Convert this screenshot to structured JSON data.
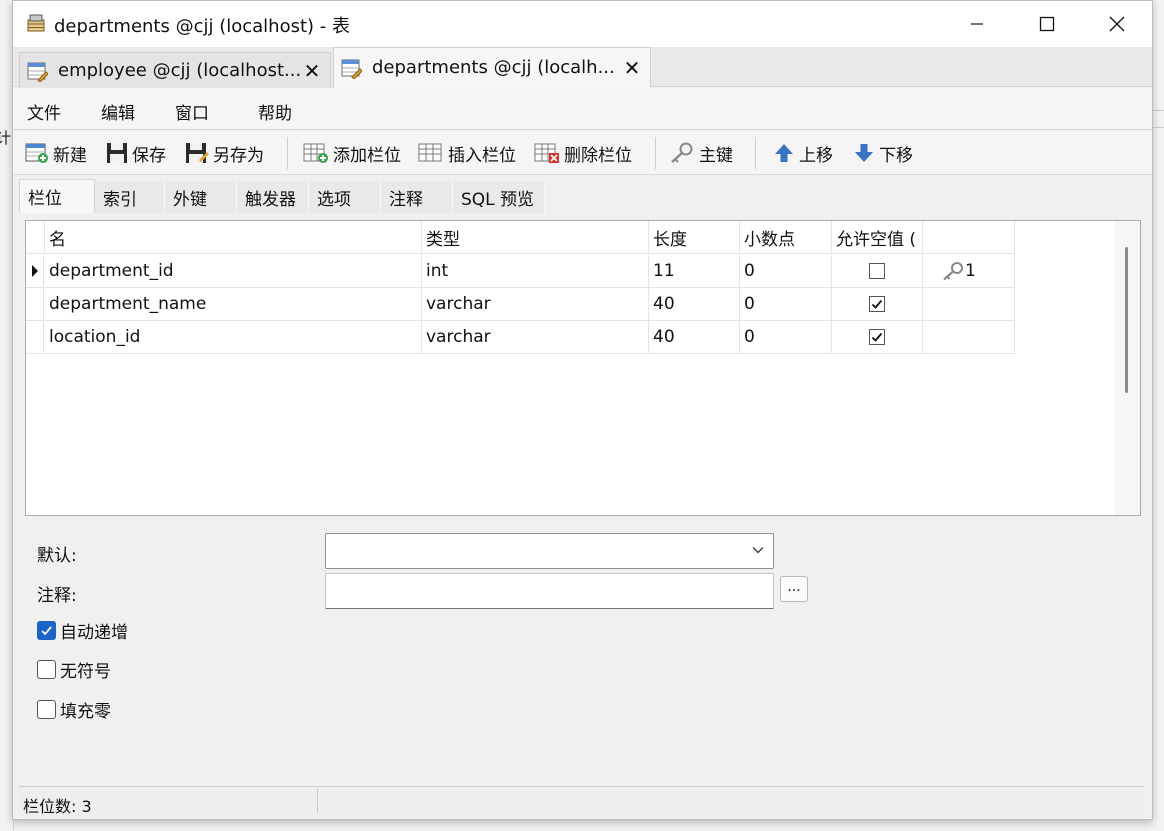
{
  "window": {
    "title": "departments @cjj (localhost) - 表"
  },
  "doc_tabs": [
    {
      "label": "employee @cjj (localhost...",
      "close": "✕"
    },
    {
      "label": "departments @cjj (localh...",
      "close": "✕"
    }
  ],
  "menu": [
    "文件",
    "编辑",
    "窗口",
    "帮助"
  ],
  "toolbar": {
    "new": "新建",
    "save": "保存",
    "save_as": "另存为",
    "add_field": "添加栏位",
    "insert_field": "插入栏位",
    "delete_field": "删除栏位",
    "primary_key": "主键",
    "move_up": "上移",
    "move_down": "下移"
  },
  "inner_tabs": [
    "栏位",
    "索引",
    "外键",
    "触发器",
    "选项",
    "注释",
    "SQL 预览"
  ],
  "grid": {
    "headers": [
      "名",
      "类型",
      "长度",
      "小数点",
      "允许空值 (",
      ""
    ],
    "rows": [
      {
        "name": "department_id",
        "type": "int",
        "length": "11",
        "decimals": "0",
        "nullable": false,
        "key": "1",
        "current": true
      },
      {
        "name": "department_name",
        "type": "varchar",
        "length": "40",
        "decimals": "0",
        "nullable": true,
        "key": "",
        "current": false
      },
      {
        "name": "location_id",
        "type": "varchar",
        "length": "40",
        "decimals": "0",
        "nullable": true,
        "key": "",
        "current": false
      }
    ]
  },
  "properties": {
    "default_label": "默认:",
    "default_value": "",
    "comment_label": "注释:",
    "comment_value": "",
    "ellipsis": "...",
    "auto_increment_label": "自动递增",
    "auto_increment": true,
    "unsigned_label": "无符号",
    "unsigned": false,
    "zerofill_label": "填充零",
    "zerofill": false
  },
  "status": {
    "field_count": "栏位数: 3"
  },
  "colors": {
    "accent": "#1a63c7"
  }
}
